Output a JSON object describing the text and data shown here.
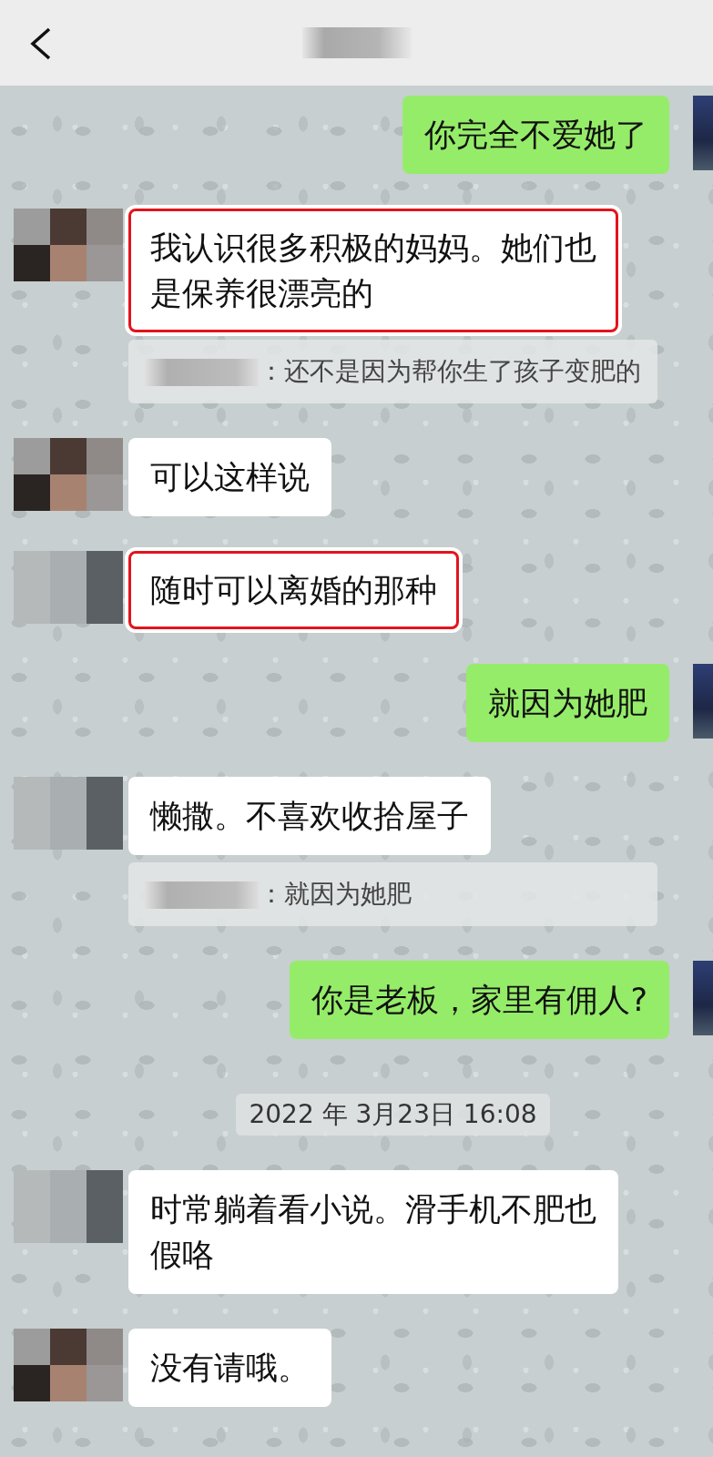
{
  "messages": [
    {
      "kind": "sent",
      "text": "你完全不爱她了",
      "highlighted": false
    },
    {
      "kind": "received",
      "text": "我认识很多积极的妈妈。她们也是保养很漂亮的",
      "highlighted": true
    },
    {
      "kind": "quote",
      "text": "：还不是因为帮你生了孩子变肥的"
    },
    {
      "kind": "received",
      "text": "可以这样说",
      "highlighted": false
    },
    {
      "kind": "received",
      "text": "随时可以离婚的那种",
      "highlighted": true
    },
    {
      "kind": "sent",
      "text": "就因为她肥",
      "highlighted": false
    },
    {
      "kind": "received",
      "text": "懒撒。不喜欢收拾屋子",
      "highlighted": false
    },
    {
      "kind": "quote",
      "text": "：就因为她肥"
    },
    {
      "kind": "sent",
      "text": "你是老板，家里有佣人?",
      "highlighted": false
    },
    {
      "kind": "time",
      "text": "2022 年 3月23日 16:08"
    },
    {
      "kind": "received",
      "text": "时常躺着看小说。滑手机不肥也假咯",
      "highlighted": false
    },
    {
      "kind": "received",
      "text": "没有请哦。",
      "highlighted": false
    }
  ]
}
